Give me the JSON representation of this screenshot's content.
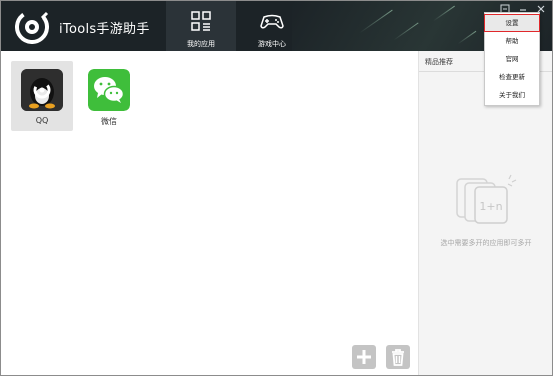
{
  "app": {
    "title": "iTools手游助手"
  },
  "tabs": [
    {
      "label": "我的应用",
      "icon": "grid-icon",
      "active": true
    },
    {
      "label": "游戏中心",
      "icon": "gamepad-icon",
      "active": false
    }
  ],
  "window_controls": [
    "settings-icon",
    "minimize-icon",
    "close-icon"
  ],
  "apps": [
    {
      "label": "QQ",
      "icon": "qq-penguin-icon",
      "selected": true
    },
    {
      "label": "微信",
      "icon": "wechat-icon",
      "selected": false
    }
  ],
  "bottom_actions": [
    {
      "icon": "plus-icon"
    },
    {
      "icon": "trash-icon"
    }
  ],
  "sidebar": {
    "title": "精品推荐",
    "hint": "选中需要多开的应用即可多开",
    "illustration_text": "1+n"
  },
  "menu": {
    "items": [
      "设置",
      "帮助",
      "官网",
      "检查更新",
      "关于我们"
    ],
    "highlighted": "设置"
  },
  "colors": {
    "header": "#1c2327",
    "active_tab": "#2b3338",
    "wechat": "#3fbe3b",
    "highlight_outline": "#e0282b"
  }
}
